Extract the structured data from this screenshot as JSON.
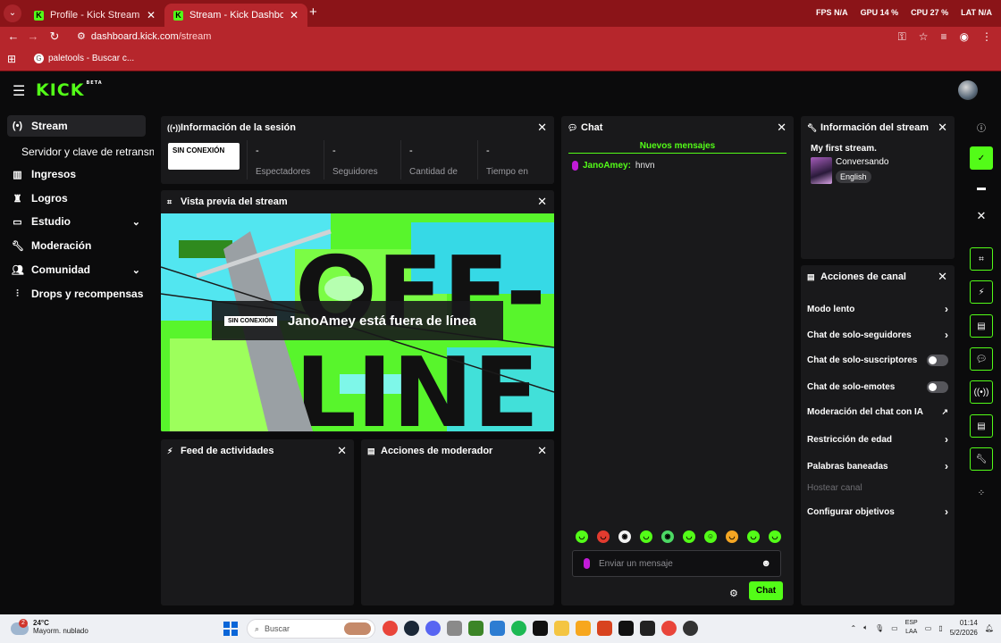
{
  "browser": {
    "tabs": [
      {
        "title": "Profile - Kick Streaming",
        "active": false
      },
      {
        "title": "Stream - Kick Dashboard",
        "active": true
      }
    ],
    "url_host": "dashboard.kick.com",
    "url_path": "/stream",
    "bookmark": "paletools - Buscar c...",
    "hud": {
      "fps_label": "FPS",
      "fps": "N/A",
      "gpu_label": "GPU",
      "gpu": "14 %",
      "cpu_label": "CPU",
      "cpu": "27 %",
      "lat_label": "LAT",
      "lat": "N/A"
    }
  },
  "header": {
    "logo": "KICK",
    "logo_sup": "BETA"
  },
  "sidebar": {
    "items": [
      {
        "label": "Stream",
        "icon": "broadcast-icon"
      },
      {
        "label": "Ingresos",
        "icon": "chart-icon"
      },
      {
        "label": "Logros",
        "icon": "trophy-icon"
      },
      {
        "label": "Estudio",
        "icon": "studio-icon"
      },
      {
        "label": "Moderación",
        "icon": "wrench-icon"
      },
      {
        "label": "Comunidad",
        "icon": "people-icon"
      },
      {
        "label": "Drops y recompensas",
        "icon": "drops-icon"
      }
    ],
    "sub_item": "Servidor y clave de retransmisión"
  },
  "session": {
    "title": "Información de la sesión",
    "badge": "SIN CONEXIÓN",
    "stats": [
      {
        "value": "-",
        "label": "Espectadores"
      },
      {
        "value": "-",
        "label": "Seguidores"
      },
      {
        "value": "-",
        "label": "Cantidad de"
      },
      {
        "value": "-",
        "label": "Tiempo en"
      }
    ]
  },
  "preview": {
    "title": "Vista previa del stream",
    "badge": "SIN CONEXIÓN",
    "message": "JanoAmey está fuera de línea",
    "bg_word_1": "OFF-",
    "bg_word_2": "LINE"
  },
  "activity": {
    "title": "Feed de actividades"
  },
  "modactions": {
    "title": "Acciones de moderador"
  },
  "chat": {
    "title": "Chat",
    "new_messages": "Nuevos mensajes",
    "messages": [
      {
        "user": "JanoAmey:",
        "text": "hnvn"
      }
    ],
    "placeholder": "Enviar un mensaje",
    "send": "Chat"
  },
  "stream_info": {
    "title": "Información del stream",
    "stream_title": "My first stream.",
    "category": "Conversando",
    "tag": "English"
  },
  "channel_actions": {
    "title": "Acciones de canal",
    "items": [
      {
        "label": "Modo lento",
        "kind": "arrow"
      },
      {
        "label": "Chat de solo-seguidores",
        "kind": "arrow"
      },
      {
        "label": "Chat de solo-suscriptores",
        "kind": "toggle"
      },
      {
        "label": "Chat de solo-emotes",
        "kind": "toggle"
      },
      {
        "label": "Moderación del chat con IA",
        "kind": "external"
      },
      {
        "label": "Restricción de edad",
        "kind": "arrow"
      },
      {
        "label": "Palabras baneadas",
        "kind": "arrow"
      },
      {
        "label": "Hostear canal",
        "kind": "disabled"
      },
      {
        "label": "Configurar objetivos",
        "kind": "arrow"
      }
    ]
  },
  "taskbar": {
    "temp": "24°C",
    "weather": "Mayorm. nublado",
    "notif": "2",
    "search": "Buscar",
    "lang_1": "ESP",
    "lang_2": "LAA",
    "time": "01:14",
    "date": "5/2/2026"
  },
  "colors": {
    "accent": "#53fc18",
    "browser_red": "#b6262c",
    "panel": "#19191b"
  }
}
